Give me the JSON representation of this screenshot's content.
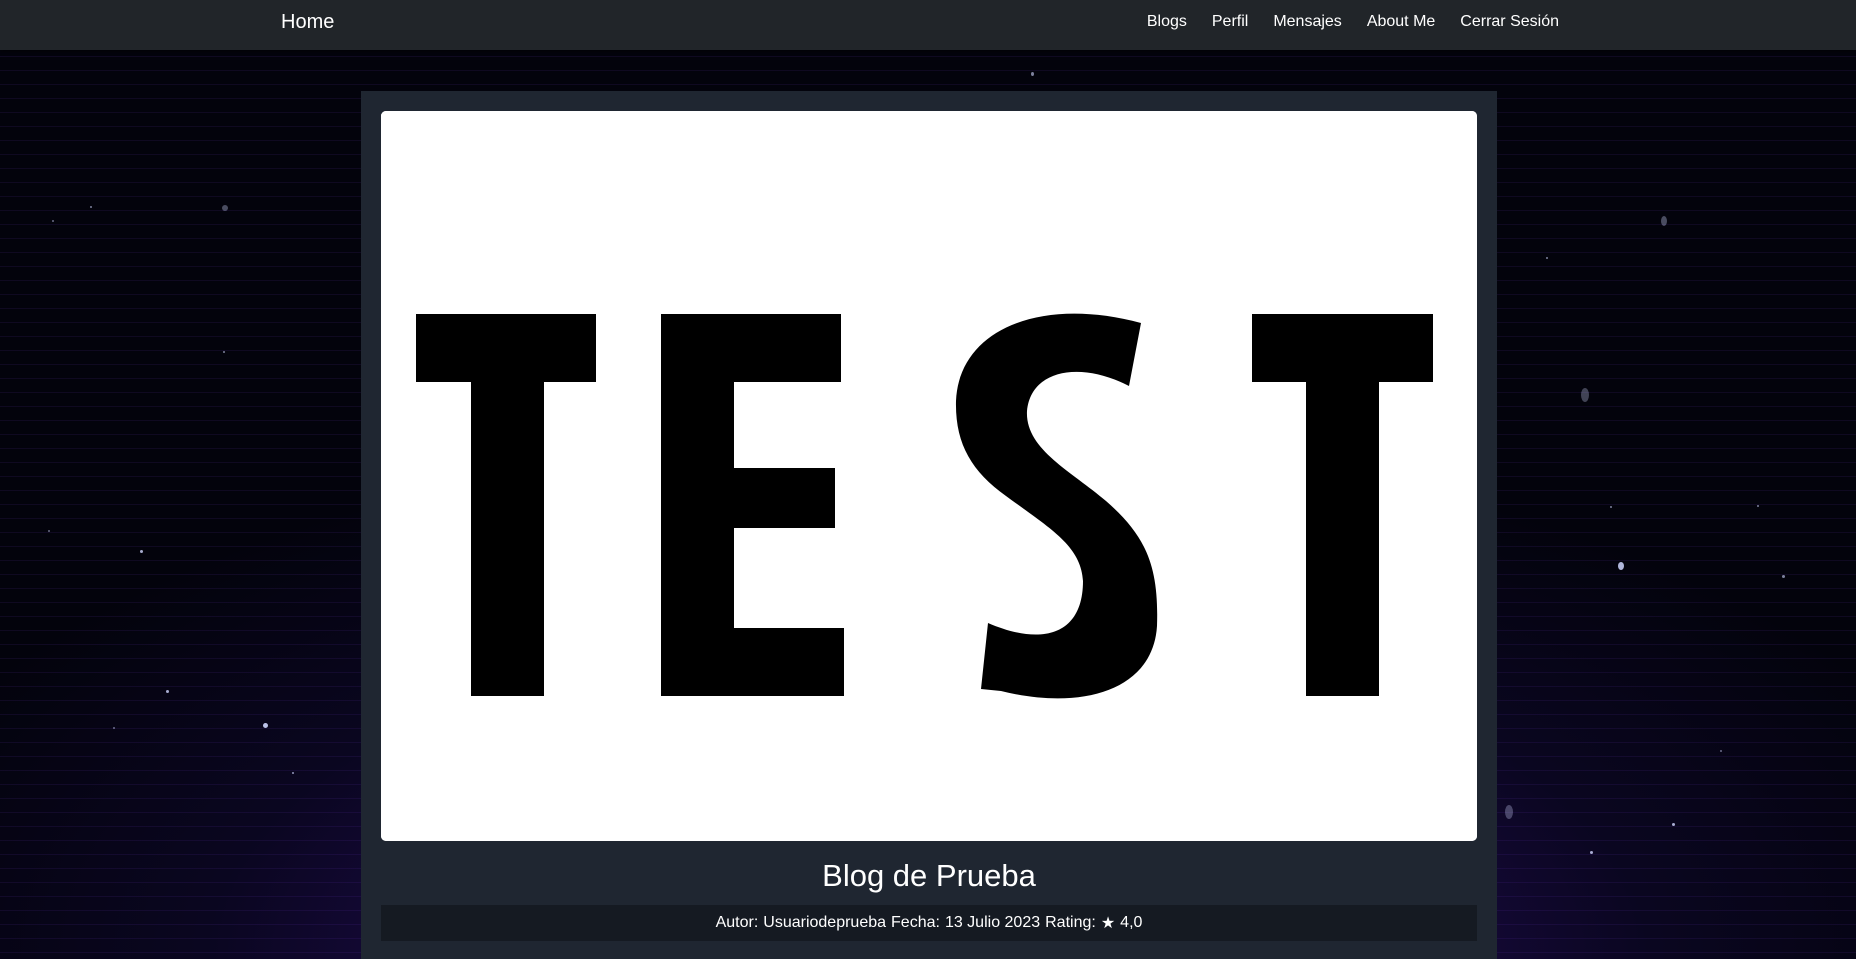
{
  "navbar": {
    "brand": "Home",
    "links": [
      "Blogs",
      "Perfil",
      "Mensajes",
      "About Me",
      "Cerrar Sesión"
    ]
  },
  "post": {
    "image_text": "TEST",
    "title": "Blog de Prueba",
    "author_label": "Autor:",
    "author": "Usuariodeprueba",
    "date_label": "Fecha:",
    "date": "13 Julio 2023",
    "rating_label": "Rating:",
    "rating_icon": "star-icon",
    "rating": "4,0"
  },
  "colors": {
    "navbar": "#212529",
    "card": "#1f2631",
    "meta_bar": "#151a22",
    "background_glow": "#3a1478"
  }
}
